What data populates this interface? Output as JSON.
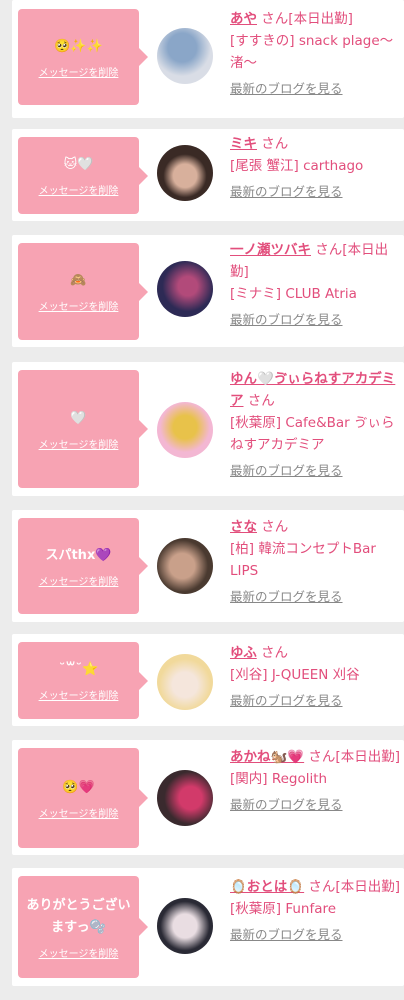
{
  "messages": [
    {
      "name": "あや",
      "honorific": "さん",
      "status": "[本日出勤]",
      "shop": "[すすきの] snack plage〜渚〜",
      "message": "🥺✨✨",
      "delete_label": "メッセージを削除",
      "blog_label": "最新のブログを見る",
      "avatar_colors": [
        "#8aa6c8",
        "#d9dde6"
      ]
    },
    {
      "name": "ミキ",
      "honorific": "さん",
      "status": "",
      "shop": "[尾張 蟹江] carthago",
      "message": "🐱🤍",
      "delete_label": "メッセージを削除",
      "blog_label": "最新のブログを見る",
      "avatar_colors": [
        "#3a2a25",
        "#d8b09c"
      ]
    },
    {
      "name": "一ノ瀬ツバキ",
      "honorific": "さん",
      "status": "[本日出勤]",
      "shop": "[ミナミ] CLUB Atria",
      "message": "🙈",
      "delete_label": "メッセージを削除",
      "blog_label": "最新のブログを見る",
      "avatar_colors": [
        "#2d2a55",
        "#b24a7a"
      ]
    },
    {
      "name": "ゆん🤍ゔぃらねすアカデミア",
      "honorific": "さん",
      "status": "",
      "shop": "[秋葉原] Cafe&Bar ゔぃらねすアカデミア",
      "message": "🤍",
      "delete_label": "メッセージを削除",
      "blog_label": "最新のブログを見る",
      "avatar_colors": [
        "#f3b7d3",
        "#e8c24a"
      ]
    },
    {
      "name": "さな",
      "honorific": "さん",
      "status": "",
      "shop": "[柏] 韓流コンセプトBar LIPS",
      "message": "スパthx💜",
      "delete_label": "メッセージを削除",
      "blog_label": "最新のブログを見る",
      "avatar_colors": [
        "#4a3a30",
        "#c9a08a"
      ]
    },
    {
      "name": "ゆふ",
      "honorific": "さん",
      "status": "",
      "shop": "[刈谷] J-QUEEN 刈谷",
      "message": "˘꒳˘⭐",
      "delete_label": "メッセージを削除",
      "blog_label": "最新のブログを見る",
      "avatar_colors": [
        "#f1d99b",
        "#f5e6dc"
      ]
    },
    {
      "name": "あかね🐿️💗",
      "honorific": "さん",
      "status": "[本日出勤]",
      "shop": "[関内] Regolith",
      "message": "🥺💗",
      "delete_label": "メッセージを削除",
      "blog_label": "最新のブログを見る",
      "avatar_colors": [
        "#3a2a2e",
        "#d23a6a"
      ]
    },
    {
      "name": "🪞おとは🪞",
      "honorific": "さん",
      "status": "[本日出勤]",
      "shop": "[秋葉原] Funfare",
      "message": "ありがとうございますっ🫧",
      "delete_label": "メッセージを削除",
      "blog_label": "最新のブログを見る",
      "avatar_colors": [
        "#2a2a35",
        "#e9dde2"
      ]
    }
  ]
}
